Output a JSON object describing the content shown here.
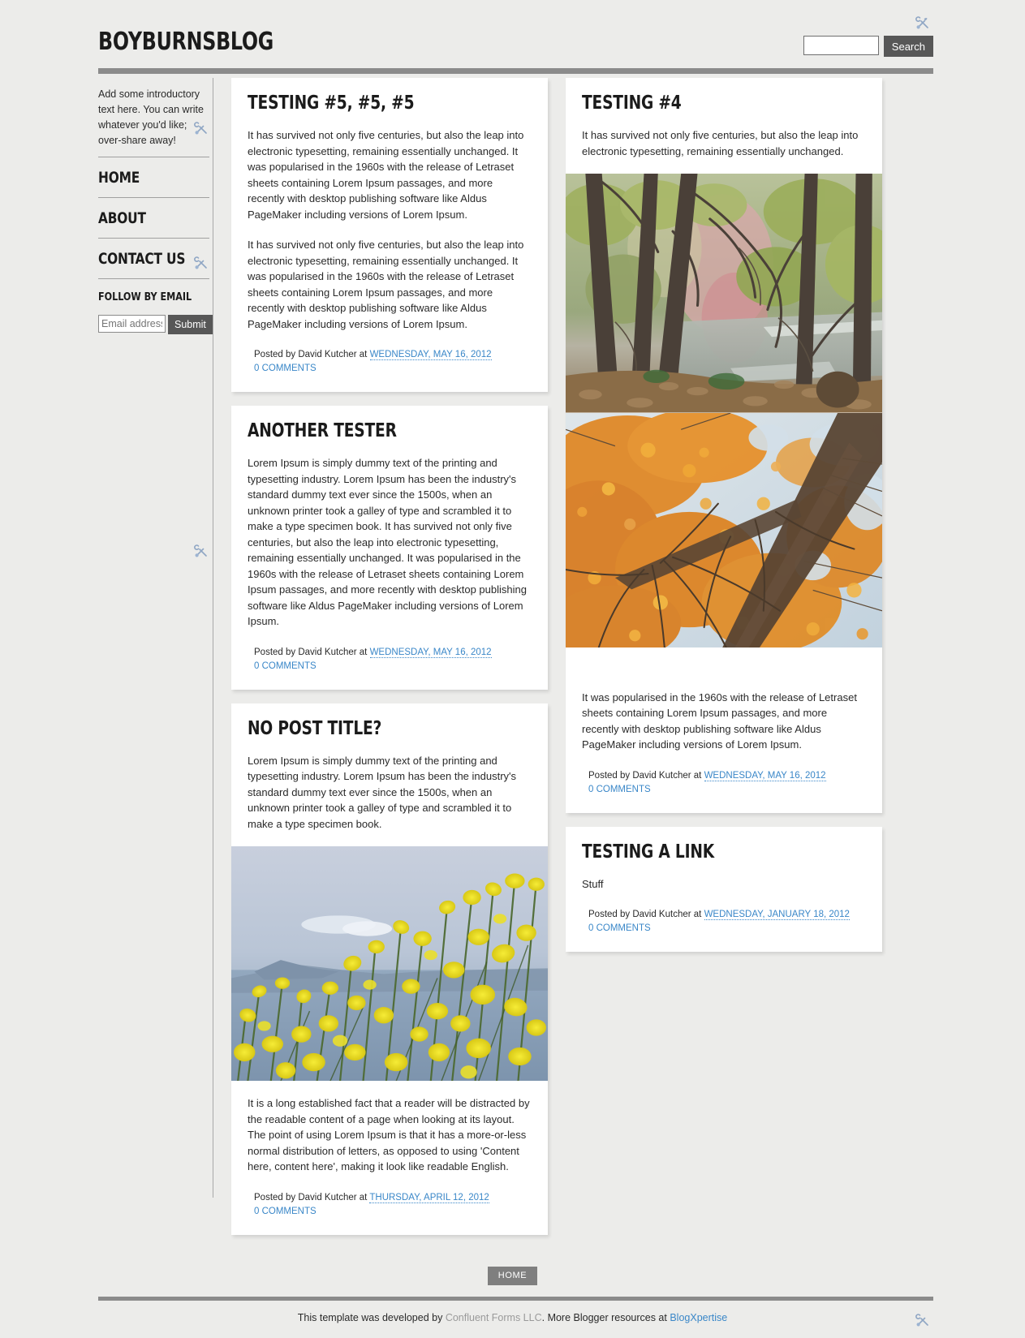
{
  "header": {
    "blog_title": "BOYBURNSBLOG",
    "search": {
      "value": "",
      "placeholder": "",
      "button_label": "Search"
    },
    "widget_icon": "wrench-screwdriver-icon"
  },
  "sidebar": {
    "intro_text": "Add some introductory text here. You can write whatever you'd like; over-share away!",
    "nav_items": [
      {
        "label": "HOME"
      },
      {
        "label": "ABOUT"
      },
      {
        "label": "CONTACT US"
      }
    ],
    "follow": {
      "title": "FOLLOW BY EMAIL",
      "email_placeholder": "Email address",
      "email_value": "",
      "submit_label": "Submit"
    }
  },
  "posts": {
    "left_column": [
      {
        "title": "TESTING #5, #5, #5",
        "paragraphs": [
          "It has survived not only five centuries, but also the leap into electronic typesetting, remaining essentially unchanged. It was popularised in the 1960s with the release of Letraset sheets containing Lorem Ipsum passages, and more recently with desktop publishing software like Aldus PageMaker including versions of Lorem Ipsum.",
          "It has survived not only five centuries, but also the leap into electronic typesetting, remaining essentially unchanged. It was popularised in the 1960s with the release of Letraset sheets containing Lorem Ipsum passages, and more recently with desktop publishing software like Aldus PageMaker including versions of Lorem Ipsum."
        ],
        "posted_prefix": "Posted by David Kutcher at",
        "date": "WEDNESDAY, MAY 16, 2012",
        "comments": "0 COMMENTS"
      },
      {
        "title": "ANOTHER TESTER",
        "paragraphs": [
          "Lorem Ipsum is simply dummy text of the printing and typesetting industry. Lorem Ipsum has been the industry's standard dummy text ever since the 1500s, when an unknown printer took a galley of type and scrambled it to make a type specimen book. It has survived not only five centuries, but also the leap into electronic typesetting, remaining essentially unchanged. It was popularised in the 1960s with the release of Letraset sheets containing Lorem Ipsum passages, and more recently with desktop publishing software like Aldus PageMaker including versions of Lorem Ipsum."
        ],
        "posted_prefix": "Posted by David Kutcher at",
        "date": "WEDNESDAY, MAY 16, 2012",
        "comments": "0 COMMENTS"
      },
      {
        "title": "NO POST TITLE?",
        "paragraph_before": "Lorem Ipsum is simply dummy text of the printing and typesetting industry. Lorem Ipsum has been the industry's standard dummy text ever since the 1500s, when an unknown printer took a galley of type and scrambled it to make a type specimen book.",
        "image_alt": "yellow-broom-flowers-over-sea-photo",
        "paragraph_after": "It is a long established fact that a reader will be distracted by the readable content of a page when looking at its layout. The point of using Lorem Ipsum is that it has a more-or-less normal distribution of letters, as opposed to using 'Content here, content here', making it look like readable English.",
        "posted_prefix": "Posted by David Kutcher at",
        "date": "THURSDAY, APRIL 12, 2012",
        "comments": "0 COMMENTS"
      }
    ],
    "right_column": [
      {
        "title": "TESTING #4",
        "paragraph_before": "It has survived not only five centuries, but also the leap into electronic typesetting, remaining essentially unchanged.",
        "image_alt_1": "autumn-forest-stream-photo",
        "image_alt_2": "autumn-canopy-looking-up-photo",
        "paragraph_after": "It was popularised in the 1960s with the release of Letraset sheets containing Lorem Ipsum passages, and more recently with desktop publishing software like Aldus PageMaker including versions of Lorem Ipsum.",
        "posted_prefix": "Posted by David Kutcher at",
        "date": "WEDNESDAY, MAY 16, 2012",
        "comments": "0 COMMENTS"
      },
      {
        "title": "TESTING A LINK",
        "paragraphs": [
          "Stuff"
        ],
        "posted_prefix": "Posted by David Kutcher at",
        "date": "WEDNESDAY, JANUARY 18, 2012",
        "comments": "0 COMMENTS"
      }
    ]
  },
  "footer": {
    "home_label": "HOME",
    "credit_prefix": "This template was developed by ",
    "credit_company": "Confluent Forms LLC",
    "credit_middle": ". More Blogger resources at ",
    "credit_link": "BlogXpertise",
    "widget_icon": "wrench-screwdriver-icon"
  },
  "colors": {
    "background": "#ececea",
    "rule": "#8b8b8b",
    "link": "#3a87c8",
    "button": "#575757",
    "home_button": "#7f7f7f",
    "text": "#2a2a2a"
  }
}
